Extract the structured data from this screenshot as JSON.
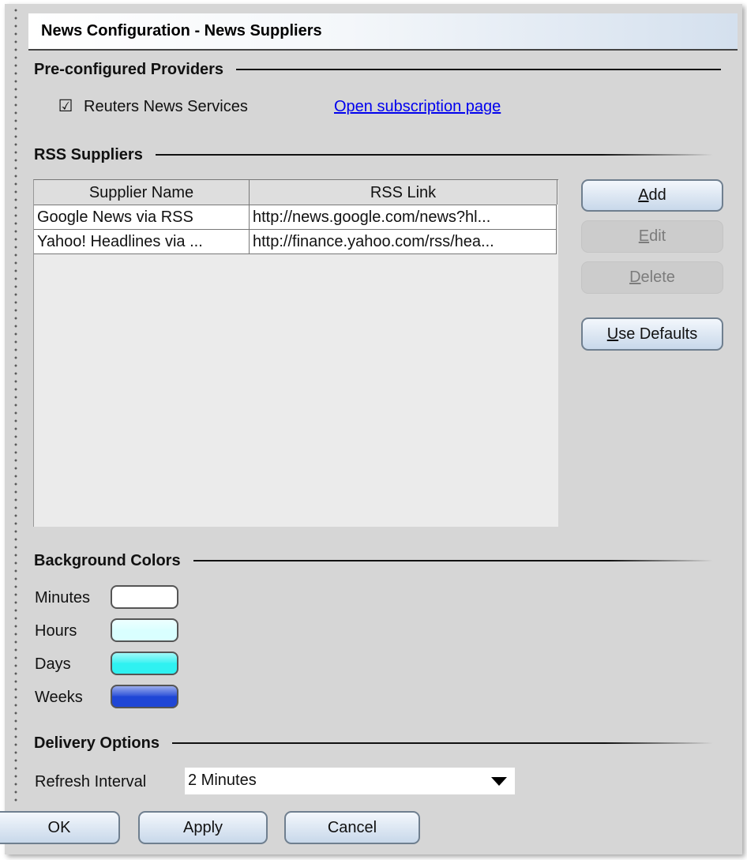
{
  "window": {
    "title": "News Configuration - News Suppliers"
  },
  "preconfigured": {
    "heading": "Pre-configured Providers",
    "check_glyph": "☑",
    "checked": true,
    "provider_label": "Reuters News Services",
    "link_label": "Open subscription page"
  },
  "rss": {
    "heading": "RSS Suppliers",
    "columns": [
      "Supplier Name",
      "RSS Link"
    ],
    "rows": [
      [
        "Google News via RSS",
        "http://news.google.com/news?hl..."
      ],
      [
        "Yahoo! Headlines via ...",
        "http://finance.yahoo.com/rss/hea..."
      ]
    ],
    "buttons": {
      "add": {
        "mnemonic": "A",
        "rest": "dd"
      },
      "edit": {
        "mnemonic": "E",
        "rest": "dit"
      },
      "delete": {
        "mnemonic": "D",
        "rest": "elete"
      },
      "defaults": {
        "mnemonic": "U",
        "rest": "se Defaults"
      }
    }
  },
  "colors": {
    "heading": "Background Colors",
    "items": [
      {
        "label": "Minutes",
        "color": "#ffffff"
      },
      {
        "label": "Hours",
        "color": "#d9ffff"
      },
      {
        "label": "Days",
        "color": "#2ff1f1"
      },
      {
        "label": "Weeks",
        "color": "#1f46d6"
      }
    ]
  },
  "delivery": {
    "heading": "Delivery Options",
    "refresh_label": "Refresh Interval",
    "refresh_value": "2 Minutes"
  },
  "footer": {
    "ok": "OK",
    "apply": "Apply",
    "cancel": "Cancel"
  }
}
